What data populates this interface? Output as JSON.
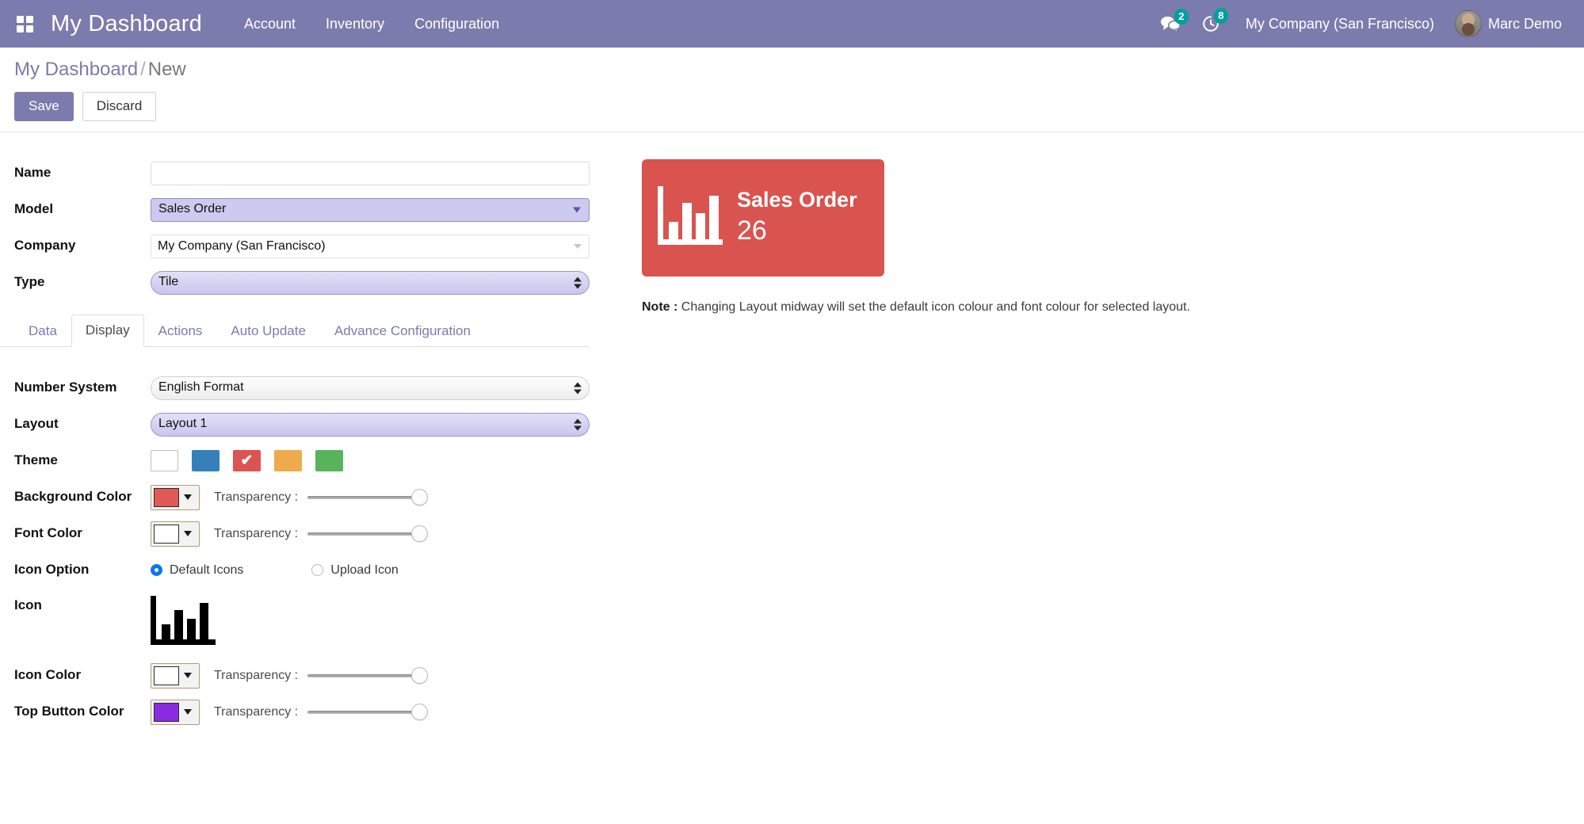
{
  "navbar": {
    "apps_icon": "apps-grid-icon",
    "brand": "My Dashboard",
    "menu": [
      {
        "label": "Account"
      },
      {
        "label": "Inventory"
      },
      {
        "label": "Configuration"
      }
    ],
    "messages_icon": "comments-icon",
    "messages_count": "2",
    "activities_icon": "clock-icon",
    "activities_count": "8",
    "company": "My Company (San Francisco)",
    "user": "Marc Demo",
    "bg_color": "#7c7bad",
    "badge_color": "#00a09d"
  },
  "control_panel": {
    "breadcrumb_root": "My Dashboard",
    "breadcrumb_sep": "/",
    "breadcrumb_current": "New",
    "save_label": "Save",
    "discard_label": "Discard"
  },
  "form": {
    "name": {
      "label": "Name",
      "value": "",
      "placeholder": ""
    },
    "model": {
      "label": "Model",
      "value": "Sales Order"
    },
    "company": {
      "label": "Company",
      "value": "My Company (San Francisco)"
    },
    "type": {
      "label": "Type",
      "value": "Tile"
    }
  },
  "notebook": {
    "tabs": [
      {
        "label": "Data",
        "active": false
      },
      {
        "label": "Display",
        "active": true
      },
      {
        "label": "Actions",
        "active": false
      },
      {
        "label": "Auto Update",
        "active": false
      },
      {
        "label": "Advance Configuration",
        "active": false
      }
    ]
  },
  "display_tab": {
    "number_system": {
      "label": "Number System",
      "value": "English Format"
    },
    "layout": {
      "label": "Layout",
      "value": "Layout 1"
    },
    "theme": {
      "label": "Theme",
      "swatches": [
        {
          "name": "theme-white",
          "color": "#ffffff",
          "selected": false
        },
        {
          "name": "theme-blue",
          "color": "#3580ba",
          "selected": false
        },
        {
          "name": "theme-red",
          "color": "#dd5252",
          "selected": true
        },
        {
          "name": "theme-orange",
          "color": "#eeaa4d",
          "selected": false
        },
        {
          "name": "theme-green",
          "color": "#57b45b",
          "selected": false
        }
      ],
      "check_glyph": "✔"
    },
    "background_color": {
      "label": "Background Color",
      "swatch": "#e05b57",
      "transparency_label": "Transparency :",
      "transparency_value": "100"
    },
    "font_color": {
      "label": "Font Color",
      "swatch": "#ffffff",
      "transparency_label": "Transparency :",
      "transparency_value": "100"
    },
    "icon_option": {
      "label": "Icon Option",
      "options": [
        {
          "label": "Default Icons",
          "selected": true
        },
        {
          "label": "Upload Icon",
          "selected": false
        }
      ]
    },
    "icon": {
      "label": "Icon",
      "icon_name": "bar-chart-icon",
      "color": "#000000"
    },
    "icon_color": {
      "label": "Icon Color",
      "swatch": "#ffffff",
      "transparency_label": "Transparency :",
      "transparency_value": "100"
    },
    "top_button_color": {
      "label": "Top Button Color",
      "swatch": "#8a2be2",
      "transparency_label": "Transparency :",
      "transparency_value": "100"
    }
  },
  "preview": {
    "tile": {
      "title": "Sales Order",
      "value": "26",
      "bg_color": "#d9534f",
      "font_color": "#ffffff",
      "icon_name": "bar-chart-icon"
    },
    "note_prefix": "Note :",
    "note_text": "Changing Layout midway will set the default icon colour and font colour for selected layout."
  }
}
